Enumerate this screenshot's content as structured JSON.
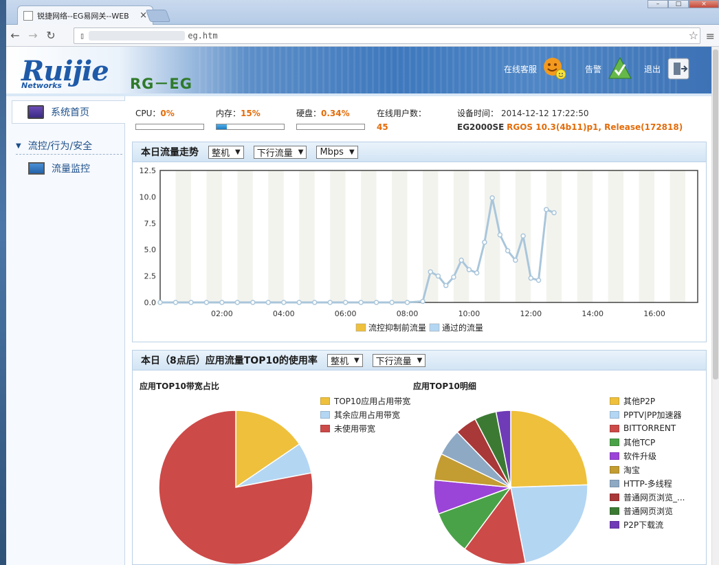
{
  "browser": {
    "tab_title": "锐捷网络--EG易网关--WEB",
    "close_glyph": "×",
    "url_suffix": "eg.htm"
  },
  "header": {
    "logo": "Ruijie",
    "logo_sub": "Networks",
    "model": "RG－EG",
    "service_label": "在线客服",
    "alarm_label": "告警",
    "logout_label": "退出"
  },
  "sidebar": {
    "home": "系统首页",
    "section": "流控/行为/安全",
    "items": [
      {
        "label": "流量监控"
      }
    ]
  },
  "status": {
    "cpu_label": "CPU：",
    "cpu_value": "0%",
    "cpu_pct": 0,
    "mem_label": "内存：",
    "mem_value": "15%",
    "mem_pct": 15,
    "disk_label": "硬盘：",
    "disk_value": "0.34%",
    "disk_pct": 0.34,
    "users_label": "在线用户数：",
    "users_value": "45",
    "time_label": "设备时间：",
    "time_value": "2014-12-12 17:22:50",
    "device_model": "EG2000SE",
    "firmware": "RGOS 10.3(4b11)p1, Release(172818)"
  },
  "traffic_panel": {
    "title": "本日流量走势",
    "sel_device": "整机",
    "sel_dir": "下行流量",
    "sel_unit": "Mbps"
  },
  "app_panel": {
    "title": "本日（8点后）应用流量TOP10的使用率",
    "sel_device": "整机",
    "sel_dir": "下行流量",
    "pie1_title": "应用TOP10带宽占比",
    "pie2_title": "应用TOP10明细"
  },
  "colors": {
    "orange": "#e36c0a",
    "yellow": "#eec03c",
    "lightblue": "#b3d6f3",
    "red": "#cc4a48"
  },
  "chart_data": [
    {
      "type": "line",
      "title": "",
      "xlabel": "",
      "ylabel": "",
      "x_ticks": [
        "02:00",
        "04:00",
        "06:00",
        "08:00",
        "10:00",
        "12:00",
        "14:00",
        "16:00"
      ],
      "y_ticks": [
        "0.0",
        "2.5",
        "5.0",
        "7.5",
        "10.0",
        "12.5"
      ],
      "ylim": [
        0,
        12.5
      ],
      "xlim_hours": [
        0,
        17.4
      ],
      "legend_position": "bottom",
      "series": [
        {
          "name": "流控抑制前流量",
          "color": "#eec03c",
          "values": []
        },
        {
          "name": "通过的流量",
          "color": "#b3d6f3",
          "x_hours": [
            0,
            1,
            2,
            3,
            4,
            5,
            6,
            7,
            8,
            9,
            10,
            11,
            12,
            13,
            14,
            15,
            16,
            17,
            17.5,
            18,
            18.5,
            19,
            19.5,
            20,
            20.5,
            21,
            21.5,
            22,
            22.5,
            23,
            23.5,
            24,
            24.5,
            25,
            25.5,
            26,
            26.5,
            27,
            27.5,
            28,
            28.5,
            29,
            29.5,
            30,
            30.5,
            31,
            31.5,
            32,
            32.5,
            33,
            33.5,
            34,
            34.5
          ],
          "values": [
            0,
            0,
            0,
            0,
            0,
            0,
            0,
            0,
            0,
            0,
            0,
            0,
            0,
            0,
            0,
            0,
            0,
            0.1,
            2.9,
            2.5,
            1.6,
            2.4,
            4.0,
            3.1,
            2.8,
            5.7,
            9.9,
            6.4,
            4.9,
            4.0,
            6.3,
            2.3,
            2.1,
            8.8,
            8.5
          ]
        }
      ]
    },
    {
      "type": "pie",
      "title": "应用TOP10带宽占比",
      "labels": [
        "TOP10应用占用带宽",
        "其余应用占用带宽",
        "未使用带宽"
      ],
      "colors": [
        "#eec03c",
        "#b3d6f3",
        "#cc4a48"
      ],
      "values": [
        15.5,
        6.5,
        78
      ]
    },
    {
      "type": "pie",
      "title": "应用TOP10明细",
      "labels": [
        "其他P2P",
        "PPTV|PP加速器",
        "BITTORRENT",
        "其他TCP",
        "软件升级",
        "淘宝",
        "HTTP-多线程",
        "普通网页浏览_...",
        "普通网页浏览",
        "P2P下载流"
      ],
      "colors": [
        "#eec03c",
        "#b3d6f3",
        "#cc4a48",
        "#4aa248",
        "#9b44d8",
        "#c39c32",
        "#8ea9c4",
        "#a93838",
        "#3c7a33",
        "#6f3bb6"
      ],
      "values": [
        24,
        22,
        13,
        9,
        7,
        5.5,
        5.5,
        4.5,
        4.5,
        3
      ]
    }
  ]
}
